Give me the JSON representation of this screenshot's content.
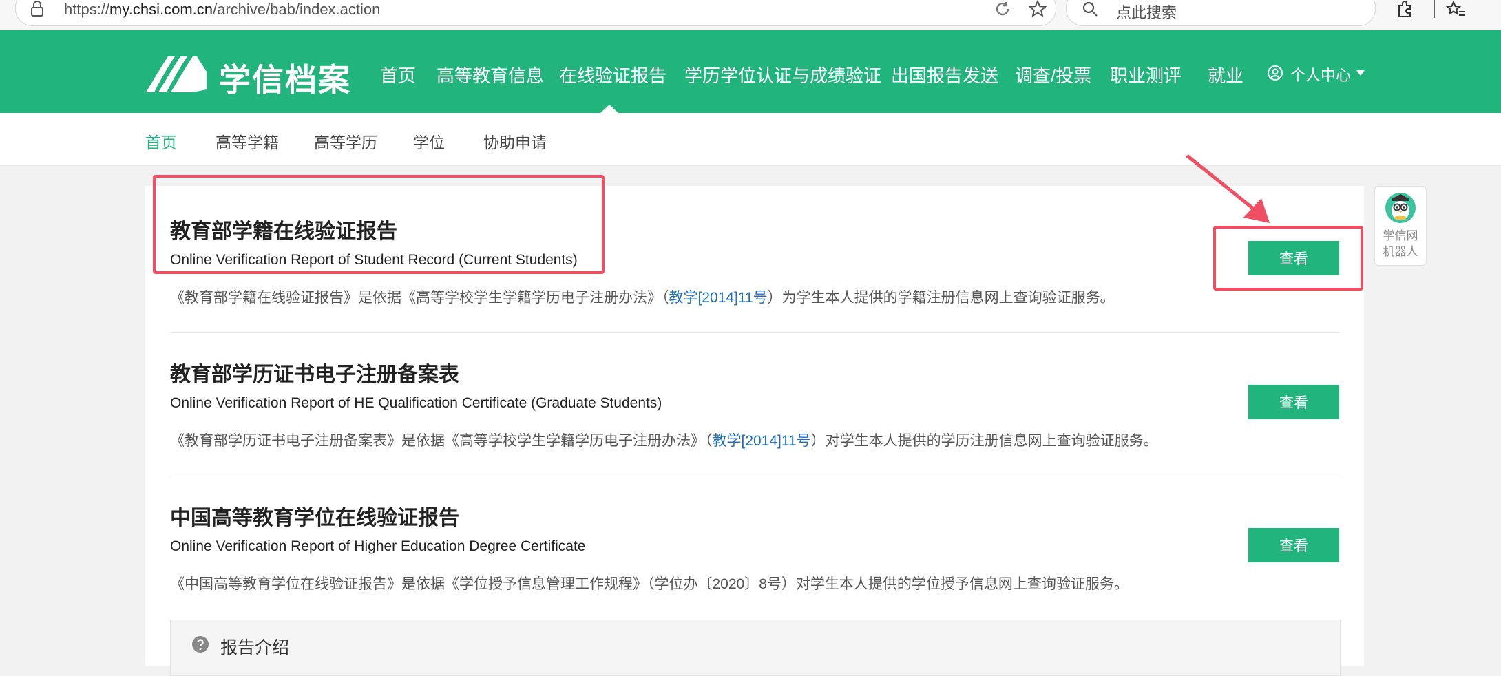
{
  "browser": {
    "url_prefix": "https://",
    "url_host": "my.chsi.com.cn",
    "url_path": "/archive/bab/index.action",
    "search_placeholder": "点此搜索"
  },
  "header": {
    "logo_text": "学信档案",
    "nav": [
      {
        "label": "首页"
      },
      {
        "label": "高等教育信息"
      },
      {
        "label": "在线验证报告",
        "active": true
      },
      {
        "label": "学历学位认证与成绩验证"
      },
      {
        "label": "出国报告发送"
      },
      {
        "label": "调查/投票"
      },
      {
        "label": "职业测评"
      },
      {
        "label": "就业"
      }
    ],
    "user_center": "个人中心"
  },
  "sub_nav": [
    {
      "label": "首页",
      "active": true
    },
    {
      "label": "高等学籍"
    },
    {
      "label": "高等学历"
    },
    {
      "label": "学位"
    },
    {
      "label": "协助申请"
    }
  ],
  "reports": [
    {
      "title": "教育部学籍在线验证报告",
      "en": "Online Verification Report of Student Record (Current Students)",
      "desc_before": "《教育部学籍在线验证报告》是依据《高等学校学生学籍学历电子注册办法》（",
      "desc_link": "教学[2014]11号",
      "desc_after": "）为学生本人提供的学籍注册信息网上查询验证服务。",
      "button": "查看"
    },
    {
      "title": "教育部学历证书电子注册备案表",
      "en": "Online Verification Report of HE Qualification Certificate (Graduate Students)",
      "desc_before": "《教育部学历证书电子注册备案表》是依据《高等学校学生学籍学历电子注册办法》（",
      "desc_link": "教学[2014]11号",
      "desc_after": "）对学生本人提供的学历注册信息网上查询验证服务。",
      "button": "查看"
    },
    {
      "title": "中国高等教育学位在线验证报告",
      "en": "Online Verification Report of Higher Education Degree Certificate",
      "desc_before": "《中国高等教育学位在线验证报告》是依据《学位授予信息管理工作规程》（学位办〔2020〕8号）对学生本人提供的学位授予信息网上查询验证服务。",
      "desc_link": "",
      "desc_after": "",
      "button": "查看"
    }
  ],
  "intro": {
    "title": "报告介绍"
  },
  "robot": {
    "line1": "学信网",
    "line2": "机器人"
  },
  "colors": {
    "brand_green": "#22b47d",
    "link_blue": "#1e6fb8",
    "annotation_red": "#f04e63"
  }
}
